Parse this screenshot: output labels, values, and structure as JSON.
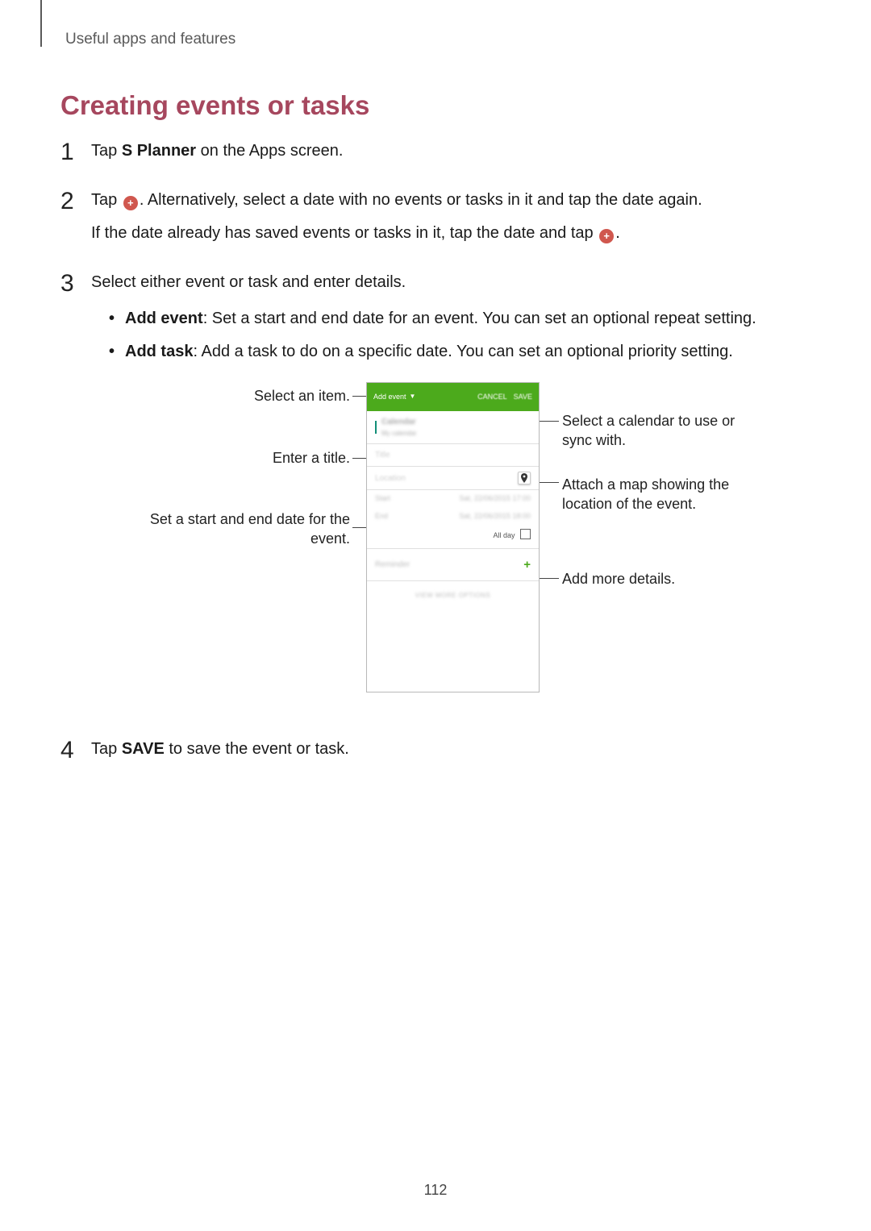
{
  "breadcrumb": "Useful apps and features",
  "heading": "Creating events or tasks",
  "steps": {
    "s1": {
      "num": "1",
      "pre": "Tap ",
      "bold": "S Planner",
      "post": " on the Apps screen."
    },
    "s2": {
      "num": "2",
      "p1a": "Tap ",
      "p1b": ". Alternatively, select a date with no events or tasks in it and tap the date again.",
      "p2a": "If the date already has saved events or tasks in it, tap the date and tap ",
      "p2b": "."
    },
    "s3": {
      "num": "3",
      "intro": "Select either event or task and enter details.",
      "b1bold": "Add event",
      "b1text": ": Set a start and end date for an event. You can set an optional repeat setting.",
      "b2bold": "Add task",
      "b2text": ": Add a task to do on a specific date. You can set an optional priority setting."
    },
    "s4": {
      "num": "4",
      "pre": "Tap ",
      "bold": "SAVE",
      "post": " to save the event or task."
    }
  },
  "callouts": {
    "c1": "Select an item.",
    "c2": "Enter a title.",
    "c3": "Set a start and end date for the event.",
    "c4": "Select a calendar to use or sync with.",
    "c5": "Attach a map showing the location of the event.",
    "c6": "Add more details."
  },
  "phone": {
    "addEvent": "Add event",
    "cancel": "CANCEL",
    "save": "SAVE",
    "calendar": "Calendar",
    "calendarSub": "My calendar",
    "title": "Title",
    "location": "Location",
    "start": "Start",
    "end": "End",
    "startVal": "Sat, 22/06/2015  17:00",
    "endVal": "Sat, 22/06/2015  18:00",
    "allDay": "All day",
    "reminder": "Reminder",
    "viewMore": "VIEW MORE OPTIONS"
  },
  "pageNumber": "112"
}
